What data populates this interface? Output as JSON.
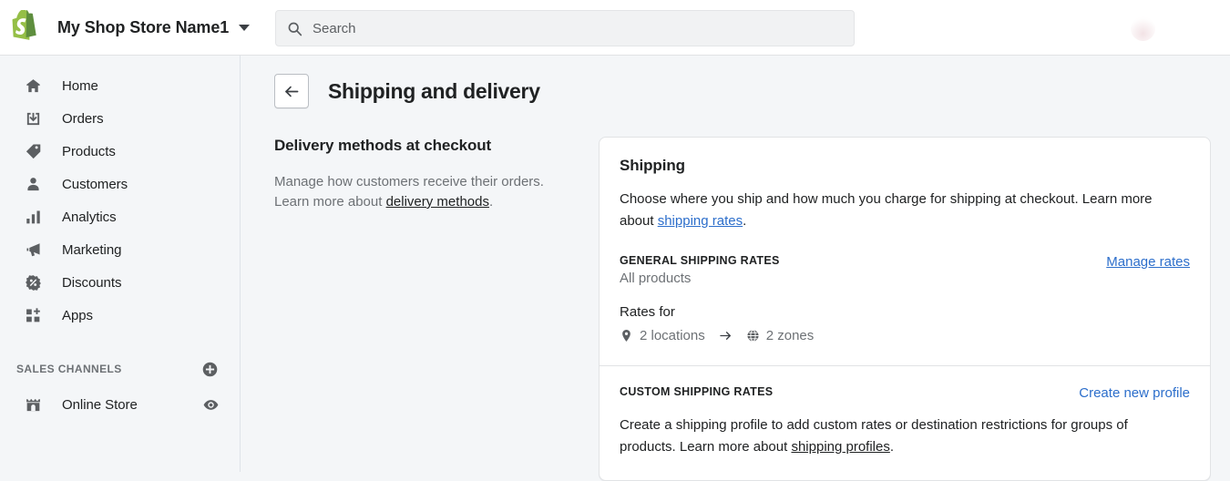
{
  "topbar": {
    "logo_icon": "shopify-bag-logo",
    "logo_color": "#95BF47",
    "store_name": "My Shop Store Name1",
    "store_caret_icon": "chevron-down-icon",
    "search": {
      "icon": "search-icon",
      "placeholder": "Search",
      "value": ""
    },
    "avatar_icon": "user-avatar"
  },
  "sidebar": {
    "items": [
      {
        "label": "Home",
        "icon": "home-icon"
      },
      {
        "label": "Orders",
        "icon": "orders-inbox-icon"
      },
      {
        "label": "Products",
        "icon": "product-tag-icon"
      },
      {
        "label": "Customers",
        "icon": "customer-person-icon"
      },
      {
        "label": "Analytics",
        "icon": "analytics-bars-icon"
      },
      {
        "label": "Marketing",
        "icon": "marketing-megaphone-icon"
      },
      {
        "label": "Discounts",
        "icon": "discount-percent-icon"
      },
      {
        "label": "Apps",
        "icon": "apps-grid-plus-icon"
      }
    ],
    "section": {
      "title": "SALES CHANNELS",
      "add_icon": "plus-circle-icon"
    },
    "channels": [
      {
        "label": "Online Store",
        "icon": "storefront-icon",
        "action_icon": "eye-icon"
      }
    ]
  },
  "page": {
    "back_icon": "arrow-left-icon",
    "title": "Shipping and delivery"
  },
  "left_column": {
    "title": "Delivery methods at checkout",
    "body_line1": "Manage how customers receive their orders.",
    "body_line2_prefix": "Learn more about ",
    "body_link": "delivery methods",
    "body_suffix": "."
  },
  "shipping_card": {
    "title": "Shipping",
    "description_prefix": "Choose where you ship and how much you charge for shipping at checkout. Learn more about ",
    "description_link": "shipping rates",
    "description_suffix": ".",
    "general": {
      "eyebrow": "GENERAL SHIPPING RATES",
      "subtitle": "All products",
      "manage_link": "Manage rates",
      "rates_for_label": "Rates for",
      "locations_icon": "map-pin-icon",
      "locations_text": "2 locations",
      "arrow_icon": "arrow-right-icon",
      "zones_icon": "globe-icon",
      "zones_text": "2 zones"
    },
    "custom": {
      "eyebrow": "CUSTOM SHIPPING RATES",
      "create_link": "Create new profile",
      "description_prefix": "Create a shipping profile to add custom rates or destination restrictions for groups of products. Learn more about ",
      "description_link": "shipping profiles",
      "description_suffix": "."
    }
  }
}
